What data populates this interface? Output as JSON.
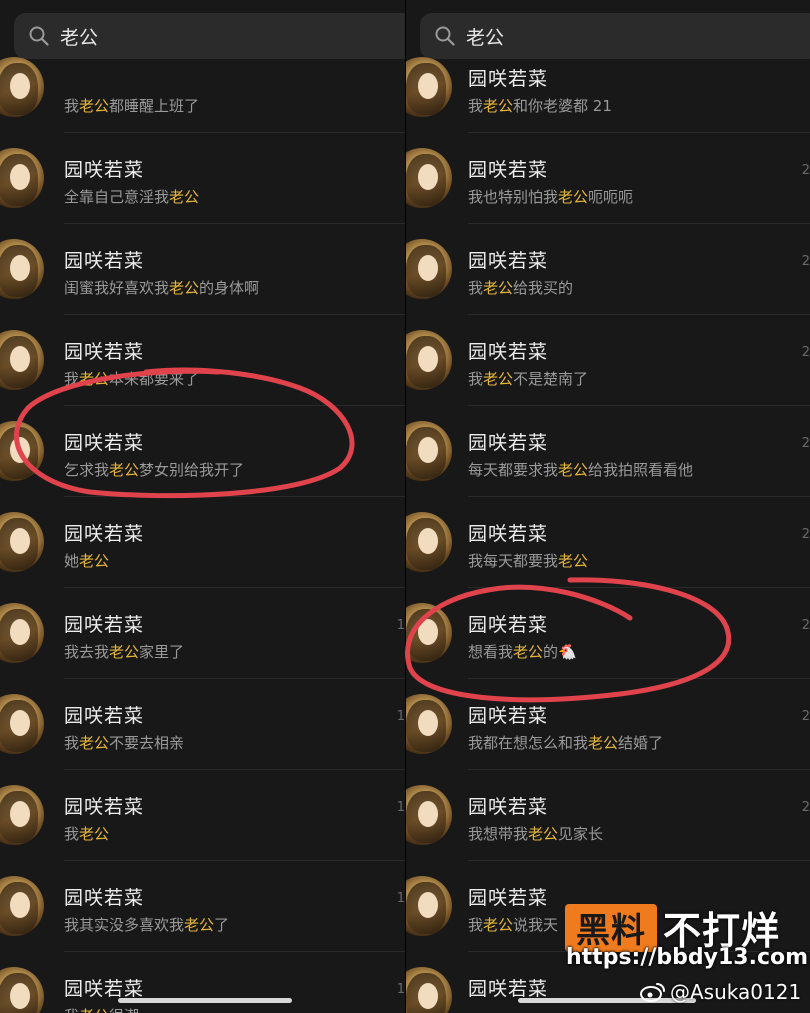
{
  "search": {
    "query": "老公"
  },
  "left_panel": {
    "results": [
      {
        "name": "",
        "snippet": [
          [
            "我",
            false
          ],
          [
            "老公",
            true
          ],
          [
            "都睡醒上班了",
            false
          ]
        ],
        "edge": ""
      },
      {
        "name": "园咲若菜",
        "snippet": [
          [
            "全靠自己意淫我",
            false
          ],
          [
            "老公",
            true
          ]
        ],
        "edge": ""
      },
      {
        "name": "园咲若菜",
        "snippet": [
          [
            "闺蜜我好喜欢我",
            false
          ],
          [
            "老公",
            true
          ],
          [
            "的身体啊",
            false
          ]
        ],
        "edge": ""
      },
      {
        "name": "园咲若菜",
        "snippet": [
          [
            "我",
            false
          ],
          [
            "老公",
            true
          ],
          [
            "本来都要来了",
            false
          ]
        ],
        "edge": ""
      },
      {
        "name": "园咲若菜",
        "snippet": [
          [
            "乞求我",
            false
          ],
          [
            "老公",
            true
          ],
          [
            "梦女别给我开了",
            false
          ]
        ],
        "edge": ""
      },
      {
        "name": "园咲若菜",
        "snippet": [
          [
            "她",
            false
          ],
          [
            "老公",
            true
          ]
        ],
        "edge": ""
      },
      {
        "name": "园咲若菜",
        "snippet": [
          [
            "我去我",
            false
          ],
          [
            "老公",
            true
          ],
          [
            "家里了",
            false
          ]
        ],
        "edge": "1"
      },
      {
        "name": "园咲若菜",
        "snippet": [
          [
            "我",
            false
          ],
          [
            "老公",
            true
          ],
          [
            "不要去相亲",
            false
          ]
        ],
        "edge": "1"
      },
      {
        "name": "园咲若菜",
        "snippet": [
          [
            "我",
            false
          ],
          [
            "老公",
            true
          ]
        ],
        "edge": "1"
      },
      {
        "name": "园咲若菜",
        "snippet": [
          [
            "我其实没多喜欢我",
            false
          ],
          [
            "老公",
            true
          ],
          [
            "了",
            false
          ]
        ],
        "edge": "1"
      },
      {
        "name": "园咲若菜",
        "snippet": [
          [
            "我",
            false
          ],
          [
            "老公",
            true
          ],
          [
            "很潮",
            false
          ]
        ],
        "edge": "1"
      }
    ]
  },
  "right_panel": {
    "results": [
      {
        "name": "园咲若菜",
        "snippet": [
          [
            "我",
            false
          ],
          [
            "老公",
            true
          ],
          [
            "和你老婆都 21",
            false
          ]
        ],
        "edge": ""
      },
      {
        "name": "园咲若菜",
        "snippet": [
          [
            "我也特别怕我",
            false
          ],
          [
            "老公",
            true
          ],
          [
            "呃呃呃",
            false
          ]
        ],
        "edge": "2"
      },
      {
        "name": "园咲若菜",
        "snippet": [
          [
            "我",
            false
          ],
          [
            "老公",
            true
          ],
          [
            "给我买的",
            false
          ]
        ],
        "edge": "2"
      },
      {
        "name": "园咲若菜",
        "snippet": [
          [
            "我",
            false
          ],
          [
            "老公",
            true
          ],
          [
            "不是楚南了",
            false
          ]
        ],
        "edge": "2"
      },
      {
        "name": "园咲若菜",
        "snippet": [
          [
            "每天都要求我",
            false
          ],
          [
            "老公",
            true
          ],
          [
            "给我拍照看看他",
            false
          ]
        ],
        "edge": "2"
      },
      {
        "name": "园咲若菜",
        "snippet": [
          [
            "我每天都要我",
            false
          ],
          [
            "老公",
            true
          ]
        ],
        "edge": "2"
      },
      {
        "name": "园咲若菜",
        "snippet": [
          [
            "想看我",
            false
          ],
          [
            "老公",
            true
          ],
          [
            "的",
            false
          ]
        ],
        "edge": "2",
        "emoji": "🐔"
      },
      {
        "name": "园咲若菜",
        "snippet": [
          [
            "我都在想怎么和我",
            false
          ],
          [
            "老公",
            true
          ],
          [
            "结婚了",
            false
          ]
        ],
        "edge": "2"
      },
      {
        "name": "园咲若菜",
        "snippet": [
          [
            "我想带我",
            false
          ],
          [
            "老公",
            true
          ],
          [
            "见家长",
            false
          ]
        ],
        "edge": "2"
      },
      {
        "name": "园咲若菜",
        "snippet": [
          [
            "我",
            false
          ],
          [
            "老公",
            true
          ],
          [
            "说我天",
            false
          ]
        ],
        "edge": ""
      },
      {
        "name": "园咲若菜",
        "snippet": [],
        "edge": ""
      }
    ]
  },
  "watermark": {
    "badge": "黑料",
    "text": "不打烊",
    "url": "https://bbdy13.com",
    "handle": "@Asuka0121"
  },
  "colors": {
    "highlight": "#e5b63c",
    "annotation": "#e0434c",
    "brand": "#f07b1f"
  }
}
